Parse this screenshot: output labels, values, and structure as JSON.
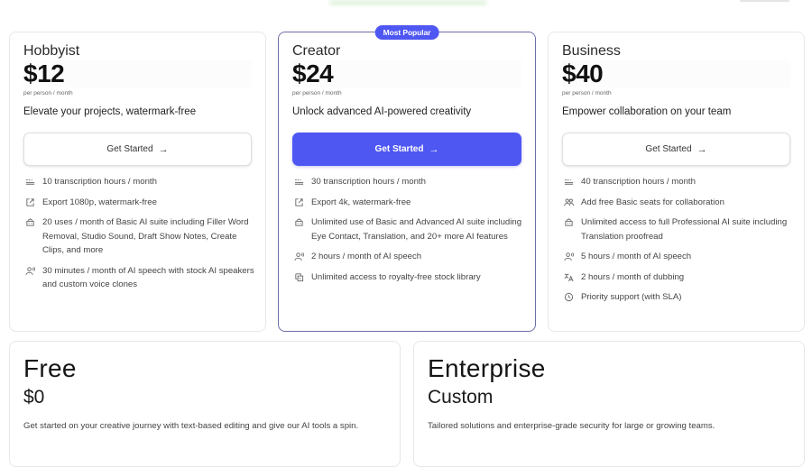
{
  "colors": {
    "accent": "#4f57f3",
    "popular_border": "#6e6ea8"
  },
  "plans": [
    {
      "name": "Hobbyist",
      "price": "$12",
      "period": "per person / month",
      "tagline": "Elevate your projects, watermark-free",
      "cta": "Get Started",
      "cta_icon": "→",
      "features": [
        {
          "icon": "transcription-icon",
          "text": "10 transcription hours / month"
        },
        {
          "icon": "export-icon",
          "text": "Export 1080p, watermark-free"
        },
        {
          "icon": "ai-suite-icon",
          "text": "20 uses / month of Basic AI suite including Filler Word Removal, Studio Sound, Draft Show Notes, Create Clips, and more"
        },
        {
          "icon": "ai-speech-icon",
          "text": "30 minutes / month of AI speech with stock AI speakers and custom voice clones"
        }
      ]
    },
    {
      "name": "Creator",
      "badge": "Most Popular",
      "price": "$24",
      "period": "per person / month",
      "tagline": "Unlock advanced AI-powered creativity",
      "cta": "Get Started",
      "cta_icon": "→",
      "features": [
        {
          "icon": "transcription-icon",
          "text": "30 transcription hours / month"
        },
        {
          "icon": "export-icon",
          "text": "Export 4k, watermark-free"
        },
        {
          "icon": "ai-suite-icon",
          "text": "Unlimited use of Basic and Advanced AI suite including Eye Contact, Translation, and 20+ more AI features"
        },
        {
          "icon": "ai-speech-icon",
          "text": "2 hours / month of AI speech"
        },
        {
          "icon": "stock-library-icon",
          "text": "Unlimited access to royalty-free stock library"
        }
      ]
    },
    {
      "name": "Business",
      "price": "$40",
      "period": "per person / month",
      "tagline": "Empower collaboration on your team",
      "cta": "Get Started",
      "cta_icon": "→",
      "features": [
        {
          "icon": "transcription-icon",
          "text": "40 transcription hours / month"
        },
        {
          "icon": "seats-icon",
          "text": "Add free Basic seats for collaboration"
        },
        {
          "icon": "ai-suite-icon",
          "text": "Unlimited access to full Professional AI suite including Translation proofread"
        },
        {
          "icon": "ai-speech-icon",
          "text": "5 hours / month of AI speech"
        },
        {
          "icon": "dubbing-icon",
          "text": "2 hours / month of dubbing"
        },
        {
          "icon": "clock-icon",
          "text": "Priority support (with SLA)"
        }
      ]
    }
  ],
  "free": {
    "name": "Free",
    "price": "$0",
    "description": "Get started on your creative journey with text-based editing and give our AI tools a spin."
  },
  "enterprise": {
    "name": "Enterprise",
    "price": "Custom",
    "description": "Tailored solutions and enterprise-grade security for large or growing teams."
  }
}
